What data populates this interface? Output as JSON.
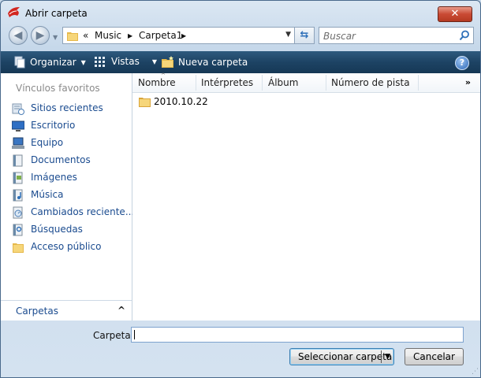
{
  "window": {
    "title": "Abrir carpeta",
    "close_label": "✕"
  },
  "address": {
    "overflow": "«",
    "segments": [
      "Music",
      "Carpeta1"
    ],
    "separator": "▶"
  },
  "search": {
    "placeholder": "Buscar"
  },
  "toolbar": {
    "organize_label": "Organizar",
    "views_label": "Vistas",
    "new_folder_label": "Nueva carpeta",
    "help_label": "?"
  },
  "sidebar": {
    "header": "Vínculos favoritos",
    "items": [
      {
        "label": "Sitios recientes",
        "icon": "recent-places-icon"
      },
      {
        "label": "Escritorio",
        "icon": "desktop-icon"
      },
      {
        "label": "Equipo",
        "icon": "computer-icon"
      },
      {
        "label": "Documentos",
        "icon": "documents-icon"
      },
      {
        "label": "Imágenes",
        "icon": "pictures-icon"
      },
      {
        "label": "Música",
        "icon": "music-icon"
      },
      {
        "label": "Cambiados reciente...",
        "icon": "recently-changed-icon"
      },
      {
        "label": "Búsquedas",
        "icon": "searches-icon"
      },
      {
        "label": "Acceso público",
        "icon": "public-folder-icon"
      }
    ],
    "folders_label": "Carpetas"
  },
  "file_list": {
    "columns": [
      "Nombre",
      "Intérpretes",
      "Álbum",
      "Número de pista"
    ],
    "more": "»",
    "items": [
      {
        "name": "2010.10.22",
        "type": "folder"
      }
    ]
  },
  "footer": {
    "folder_label": "Carpeta:",
    "folder_value": "",
    "select_button": "Seleccionar carpeta",
    "cancel_button": "Cancelar"
  },
  "colors": {
    "toolbar_bg": "#1d4364",
    "link_text": "#1a4b8f",
    "window_bg": "#c6d8ea"
  }
}
